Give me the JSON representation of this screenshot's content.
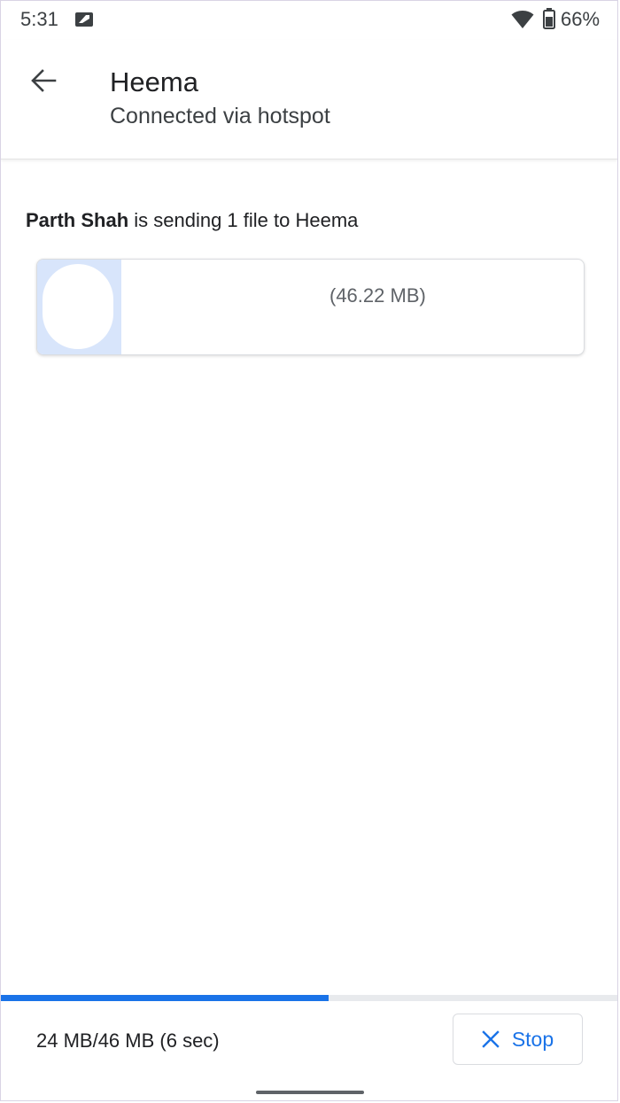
{
  "status_bar": {
    "time": "5:31",
    "battery": "66%",
    "icons": [
      "notification-icon",
      "wifi-icon",
      "battery-icon"
    ]
  },
  "header": {
    "title": "Heema",
    "subtitle": "Connected via hotspot",
    "back_icon": "arrow-back-icon"
  },
  "transfer": {
    "sender": "Parth Shah",
    "message": " is sending 1 file to Heema",
    "file": {
      "size": "(46.22 MB)"
    },
    "progress": {
      "fraction": 0.53,
      "text": "24 MB/46 MB (6 sec)"
    },
    "stop_label": "Stop",
    "stop_icon": "close-icon"
  },
  "colors": {
    "accent": "#1a73e8",
    "thumb_bg": "#d8e5fb"
  }
}
